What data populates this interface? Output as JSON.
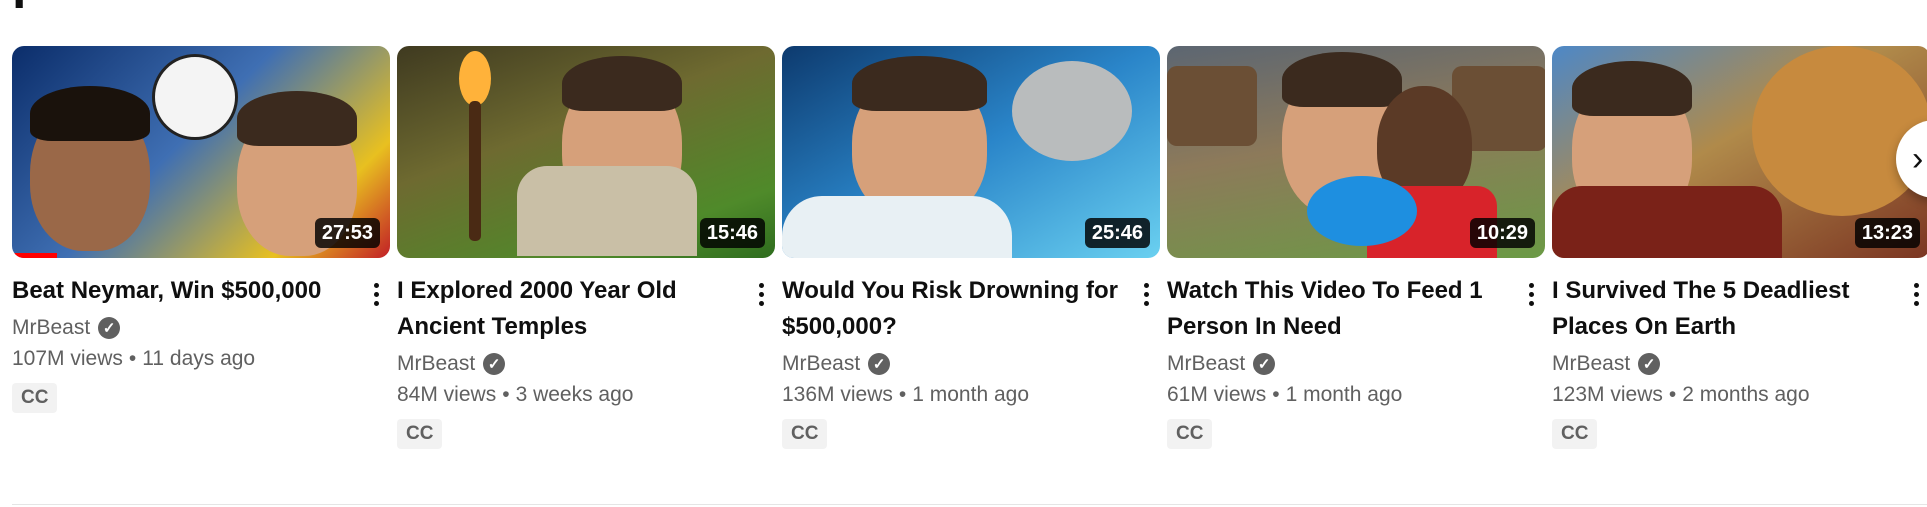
{
  "section": {
    "heading_partial": "p"
  },
  "videos": [
    {
      "title": "Beat Neymar, Win $500,000",
      "duration": "27:53",
      "channel": "MrBeast",
      "views": "107M views",
      "age": "11 days ago",
      "badge": "CC",
      "watch_progress": 0.12
    },
    {
      "title": "I Explored 2000 Year Old Ancient Temples",
      "duration": "15:46",
      "channel": "MrBeast",
      "views": "84M views",
      "age": "3 weeks ago",
      "badge": "CC"
    },
    {
      "title": "Would You Risk Drowning for $500,000?",
      "duration": "25:46",
      "channel": "MrBeast",
      "views": "136M views",
      "age": "1 month ago",
      "badge": "CC"
    },
    {
      "title": "Watch This Video To Feed 1 Person In Need",
      "duration": "10:29",
      "channel": "MrBeast",
      "views": "61M views",
      "age": "1 month ago",
      "badge": "CC"
    },
    {
      "title": "I Survived The 5 Deadliest Places On Earth",
      "duration": "13:23",
      "channel": "MrBeast",
      "views": "123M views",
      "age": "2 months ago",
      "badge": "CC"
    }
  ],
  "meta_separator": "•",
  "icons": {
    "verified": "check-circle-icon",
    "more": "more-vert-icon",
    "next": "chevron-right-icon"
  },
  "colors": {
    "progress": "#ff0000",
    "text_primary": "#0f0f0f",
    "text_secondary": "#606060",
    "badge_bg": "#f2f2f2"
  }
}
